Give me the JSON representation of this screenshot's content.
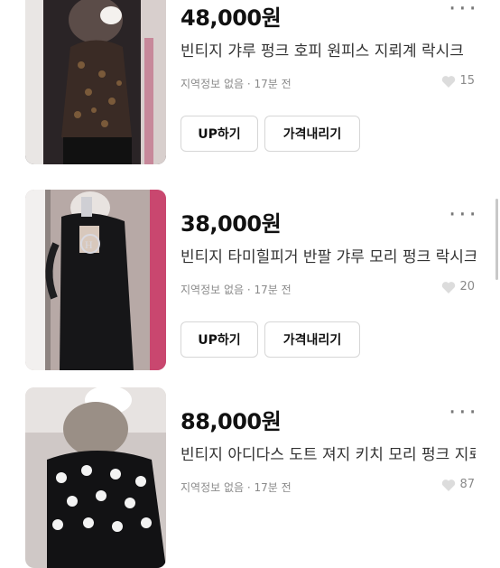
{
  "listings": [
    {
      "price": "48,000원",
      "title": "빈티지 갸루 펑크 호피 원피스 지뢰계 락시크",
      "meta": "지역정보 없음 · 17분 전",
      "likes": "15",
      "up_label": "UP하기",
      "price_down_label": "가격내리기"
    },
    {
      "price": "38,000원",
      "title": "빈티지 타미힐피거 반팔 갸루 모리 펑크 락시크",
      "meta": "지역정보 없음 · 17분 전",
      "likes": "20",
      "up_label": "UP하기",
      "price_down_label": "가격내리기"
    },
    {
      "price": "88,000원",
      "title": "빈티지 아디다스 도트 져지 키치 모리 펑크 지뢰계",
      "meta": "지역정보 없음 · 17분 전",
      "likes": "87"
    }
  ],
  "icons": {
    "more": "more-dots-icon",
    "heart": "heart-icon"
  },
  "colors": {
    "text": "#111111",
    "muted": "#8a8a8a",
    "border": "#d6d6d6"
  }
}
